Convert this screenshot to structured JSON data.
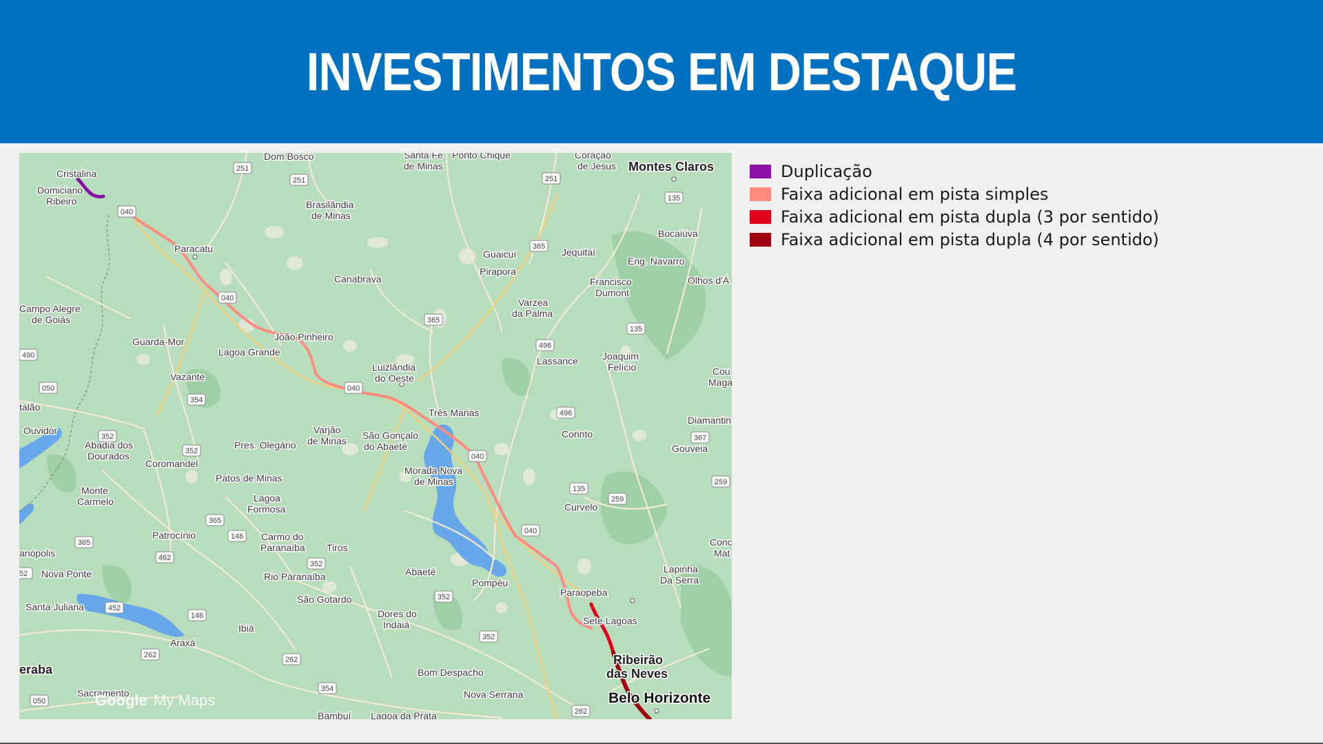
{
  "header": {
    "title": "INVESTIMENTOS EM DESTAQUE",
    "color": "#0070c0"
  },
  "map": {
    "provider": "Google My Maps",
    "attribution_google": "Google",
    "attribution_mymaps": "My Maps",
    "cities": {
      "cristalina": "Cristalina",
      "domiciano": "Domiciano",
      "ribeiro": "Ribeiro",
      "dom_bosco": "Dom Bosco",
      "santa_fe": "Santa Fé",
      "de_minas_top": "de Minas",
      "ponto_chique": "Ponto Chique",
      "coracao": "Coração",
      "de_jesus": "de Jesus",
      "montes_claros": "Montes Claros",
      "brasilandia": "Brasilândia",
      "de_minas_brasilandia": "de Minas",
      "paracatu": "Paracatu",
      "bocaiuva": "Bocaiúva",
      "guaicui": "Guaicuí",
      "pirapora": "Pirapora",
      "jequitai": "Jequitaí",
      "eng_navarro": "Eng. Navarro",
      "canabrava": "Canabrava",
      "francisco": "Francisco",
      "dumont": "Dumont",
      "olhos": "Olhos d'Á",
      "campo_alegre": "Campo Alegre",
      "de_goias": "de Goiás",
      "varzea": "Varzea",
      "da_palma": "da Palma",
      "joao_pinheiro": "João Pinheiro",
      "guarda_mor": "Guarda-Mor",
      "lagoa_grande": "Lagoa Grande",
      "lassance": "Lassance",
      "joaquim": "Joaquim",
      "felicio": "Felício",
      "luizlandia": "Luizlândia",
      "do_oeste": "do Oeste",
      "vazante": "Vazante",
      "cou": "Cou",
      "mag": "Maga",
      "catalao": "talão",
      "tres_marias": "Três Marias",
      "diamantina": "Diamantin",
      "ouvidor": "Ouvidor",
      "varjao": "Varjão",
      "de_minas_varjao": "de Minas",
      "sao_goncalo": "São Gonçalo",
      "do_abaete": "do Abaeté",
      "corinto": "Corinto",
      "abadia": "Abadia dos",
      "dourados": "Dourados",
      "pres_olegario": "Pres. Olegário",
      "gouveia": "Gouveia",
      "coromandel": "Coromandel",
      "morada_nova": "Morada Nova",
      "de_minas_morada": "de Minas",
      "patos": "Patos de Minas",
      "monte": "Monte",
      "carmelo": "Carmelo",
      "lagoa": "Lagoa",
      "formosa": "Formosa",
      "curvelo": "Curvelo",
      "patrocinio": "Patrocínio",
      "carmo": "Carmo do",
      "paranaiba": "Paranaíba",
      "tiros": "Tiros",
      "conc": "Conc",
      "mat": "Mat",
      "anopolis": "anópolis",
      "lapinha": "Lapinha",
      "da_serra": "Da Serra",
      "nova_ponte": "Nova Ponte",
      "rio_paranaiba": "Rio Paranaíba",
      "abaete": "Abaeté",
      "pompeu": "Pompéu",
      "paraopeba": "Paraopeba",
      "santa_juliana": "Santa Juliana",
      "sao_gotardo": "São Gotardo",
      "dores": "Dores do",
      "indaia": "Indaiá",
      "sete_lagoas": "Sete Lagoas",
      "ibia": "Ibiá",
      "araxa": "Araxá",
      "ribeirao": "Ribeirão",
      "das_neves": "das Neves",
      "uberaba": "eraba",
      "bom_despacho": "Bom Despacho",
      "sacramento": "Sacramento",
      "nova_serrana": "Nova Serrana",
      "belo_horizonte": "Belo Horizonte",
      "bambui": "Bambuí",
      "lagoa_prata": "Lagoa da Prata"
    },
    "shields": {
      "s251a": "251",
      "s251b": "251",
      "s251c": "251",
      "s040a": "040",
      "s040b": "040",
      "s040c": "040",
      "s040d": "040",
      "s040e": "040",
      "s135a": "135",
      "s135b": "135",
      "s135c": "135",
      "s365a": "365",
      "s365b": "365",
      "s365c": "365",
      "s365d": "365",
      "s490": "490",
      "s496a": "496",
      "s496b": "496",
      "s050a": "050",
      "s050b": "050",
      "s354a": "354",
      "s354b": "354",
      "s352a": "352",
      "s352b": "352",
      "s352c": "352",
      "s352d": "352",
      "s352e": "352",
      "s367": "367",
      "s259a": "259",
      "s259b": "259",
      "s146a": "146",
      "s146b": "146",
      "s462": "462",
      "s452": "452",
      "s262a": "262",
      "s262b": "262",
      "s262c": "262",
      "s052": "52"
    }
  },
  "legend": [
    {
      "label": "Duplicação",
      "color": "#8b10a8"
    },
    {
      "label": "Faixa adicional em pista simples",
      "color": "#ff8a80"
    },
    {
      "label": "Faixa adicional em pista dupla (3 por sentido)",
      "color": "#e0001a"
    },
    {
      "label": "Faixa adicional em pista dupla (4 por sentido)",
      "color": "#a00010"
    }
  ]
}
